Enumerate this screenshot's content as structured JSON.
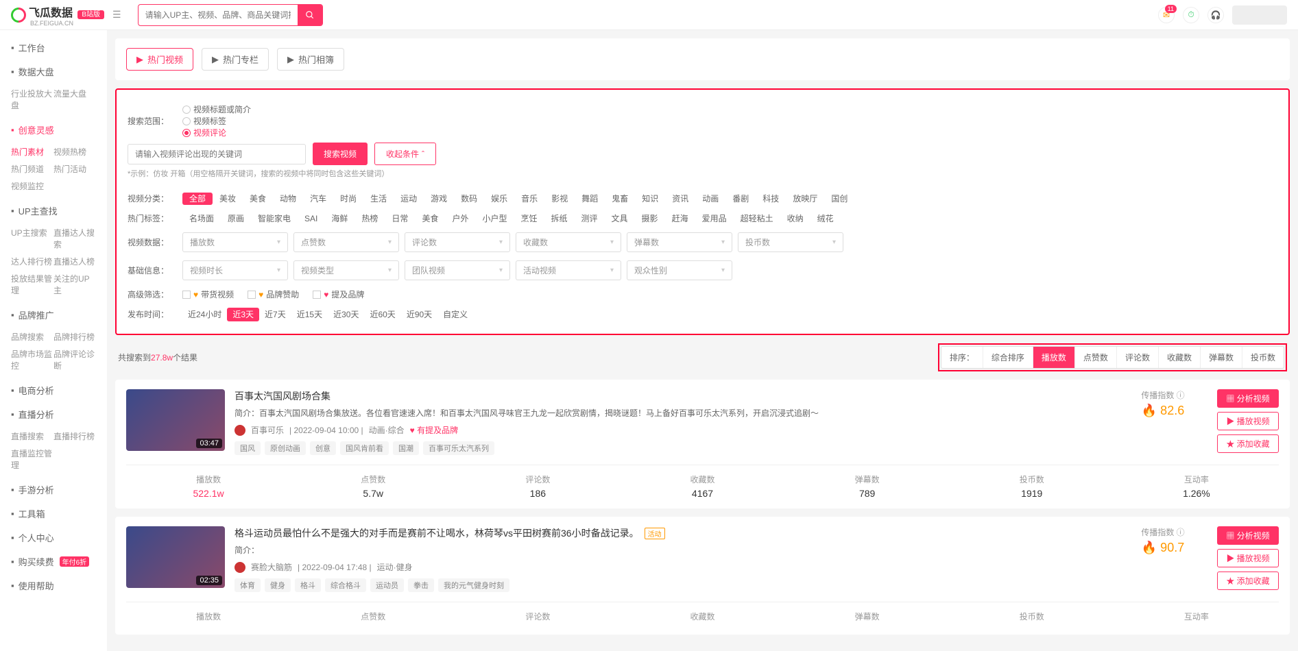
{
  "header": {
    "logo_text": "飞瓜数据",
    "logo_sub": "BZ.FEIGUA.CN",
    "logo_badge": "B站版",
    "search_placeholder": "请输入UP主、视频、品牌、商品关键词搜索",
    "notif_count": "11"
  },
  "sidebar": {
    "groups": [
      {
        "title": "工作台",
        "icon": "home-icon",
        "items": []
      },
      {
        "title": "数据大盘",
        "icon": "grid-icon",
        "items": [
          "行业投放大盘",
          "流量大盘"
        ]
      },
      {
        "title": "创意灵感",
        "icon": "bulb-icon",
        "active": true,
        "items": [
          {
            "label": "热门素材",
            "active": true
          },
          {
            "label": "视频热榜"
          },
          {
            "label": "热门频道"
          },
          {
            "label": "热门活动"
          },
          {
            "label": "视频监控"
          }
        ]
      },
      {
        "title": "UP主查找",
        "icon": "search-icon",
        "items": [
          {
            "label": "UP主搜索"
          },
          {
            "label": "直播达人搜索"
          },
          {
            "label": "达人排行榜"
          },
          {
            "label": "直播达人榜"
          },
          {
            "label": "投放结果管理"
          },
          {
            "label": "关注的UP主"
          }
        ]
      },
      {
        "title": "品牌推广",
        "icon": "diamond-icon",
        "items": [
          {
            "label": "品牌搜索"
          },
          {
            "label": "品牌排行榜"
          },
          {
            "label": "品牌市场监控"
          },
          {
            "label": "品牌评论诊断"
          }
        ]
      },
      {
        "title": "电商分析",
        "icon": "cart-icon",
        "items": []
      },
      {
        "title": "直播分析",
        "icon": "live-icon",
        "items": [
          {
            "label": "直播搜索"
          },
          {
            "label": "直播排行榜"
          },
          {
            "label": "直播监控管理"
          }
        ]
      },
      {
        "title": "手游分析",
        "icon": "mobile-icon",
        "items": []
      },
      {
        "title": "工具箱",
        "icon": "tool-icon",
        "items": []
      },
      {
        "title": "个人中心",
        "icon": "user-icon",
        "items": []
      },
      {
        "title": "购买续费",
        "icon": "cart-icon",
        "badge": "年付6折",
        "items": []
      },
      {
        "title": "使用帮助",
        "icon": "help-icon",
        "items": []
      }
    ]
  },
  "tabs": [
    {
      "label": "热门视频",
      "active": true
    },
    {
      "label": "热门专栏"
    },
    {
      "label": "热门相簿"
    }
  ],
  "search_scope": {
    "label": "搜索范围：",
    "options": [
      "视频标题或简介",
      "视频标签",
      "视频评论"
    ],
    "active_index": 2
  },
  "keyword": {
    "placeholder": "请输入视频评论出现的关键词",
    "search_btn": "搜索视频",
    "collapse_btn": "收起条件",
    "tip": "*示例：仿妆 开箱（用空格隔开关键词，搜索的视频中将同时包含这些关键词）"
  },
  "video_category": {
    "label": "视频分类：",
    "items": [
      "全部",
      "美妆",
      "美食",
      "动物",
      "汽车",
      "时尚",
      "生活",
      "运动",
      "游戏",
      "数码",
      "娱乐",
      "音乐",
      "影视",
      "舞蹈",
      "鬼畜",
      "知识",
      "资讯",
      "动画",
      "番剧",
      "科技",
      "放映厅",
      "国创"
    ],
    "active_index": 0
  },
  "hot_tags": {
    "label": "热门标签：",
    "items": [
      "名场面",
      "原画",
      "智能家电",
      "SAI",
      "海鲜",
      "热榜",
      "日常",
      "美食",
      "户外",
      "小户型",
      "烹饪",
      "拆纸",
      "测评",
      "文具",
      "摄影",
      "赶海",
      "爱用品",
      "超轻粘土",
      "收纳",
      "绒花"
    ]
  },
  "video_data": {
    "label": "视频数据：",
    "selects": [
      "播放数",
      "点赞数",
      "评论数",
      "收藏数",
      "弹幕数",
      "投币数"
    ]
  },
  "basic_info": {
    "label": "基础信息：",
    "selects": [
      "视频时长",
      "视频类型",
      "团队视频",
      "活动视频",
      "观众性别"
    ]
  },
  "adv_filter": {
    "label": "高级筛选：",
    "items": [
      {
        "label": "带货视频",
        "icon_color": "#ff9900"
      },
      {
        "label": "品牌赞助",
        "icon_color": "#ff9900"
      },
      {
        "label": "提及品牌",
        "icon_color": "#ff3366"
      }
    ]
  },
  "publish_time": {
    "label": "发布时间：",
    "items": [
      "近24小时",
      "近3天",
      "近7天",
      "近15天",
      "近30天",
      "近60天",
      "近90天",
      "自定义"
    ],
    "active_index": 1
  },
  "result": {
    "prefix": "共搜索到",
    "count": "27.8w",
    "suffix": "个结果"
  },
  "sort": {
    "label": "排序：",
    "items": [
      "综合排序",
      "播放数",
      "点赞数",
      "评论数",
      "收藏数",
      "弹幕数",
      "投币数"
    ],
    "active_index": 1
  },
  "videos": [
    {
      "title": "百事太汽国风剧场合集",
      "desc": "简介：百事太汽国风剧场合集放送。各位看官速速入席！和百事太汽国风寻味官王九龙一起欣赏剧情，揭晓谜题！马上备好百事可乐太汽系列，开启沉浸式追剧～",
      "author": "百事可乐",
      "time": "2022-09-04 10:00",
      "category": "动画·综合",
      "brand_tag": "有提及品牌",
      "tags": [
        "国风",
        "原创动画",
        "创意",
        "国风肯前看",
        "国潮",
        "百事可乐太汽系列"
      ],
      "duration": "03:47",
      "score_label": "传播指数",
      "score": "82.6",
      "stats": {
        "播放数": "522.1w",
        "点赞数": "5.7w",
        "评论数": "186",
        "收藏数": "4167",
        "弹幕数": "789",
        "投币数": "1919",
        "互动率": "1.26%"
      }
    },
    {
      "title": "格斗运动员最怕什么不是强大的对手而是赛前不让喝水，林荷琴vs平田树赛前36小时备战记录。",
      "title_badge": "活动",
      "desc": "简介：",
      "author": "赛脸大脑筋",
      "time": "2022-09-04 17:48",
      "category": "运动·健身",
      "tags": [
        "体育",
        "健身",
        "格斗",
        "综合格斗",
        "运动员",
        "拳击",
        "我的元气健身时刻"
      ],
      "duration": "02:35",
      "score_label": "传播指数",
      "score": "90.7",
      "stats": {
        "播放数": "",
        "点赞数": "",
        "评论数": "",
        "收藏数": "",
        "弹幕数": "",
        "投币数": "",
        "互动率": ""
      }
    }
  ],
  "video_actions": {
    "analyze": "分析视频",
    "play": "播放视频",
    "favorite": "添加收藏"
  },
  "stat_labels": [
    "播放数",
    "点赞数",
    "评论数",
    "收藏数",
    "弹幕数",
    "投币数",
    "互动率"
  ]
}
